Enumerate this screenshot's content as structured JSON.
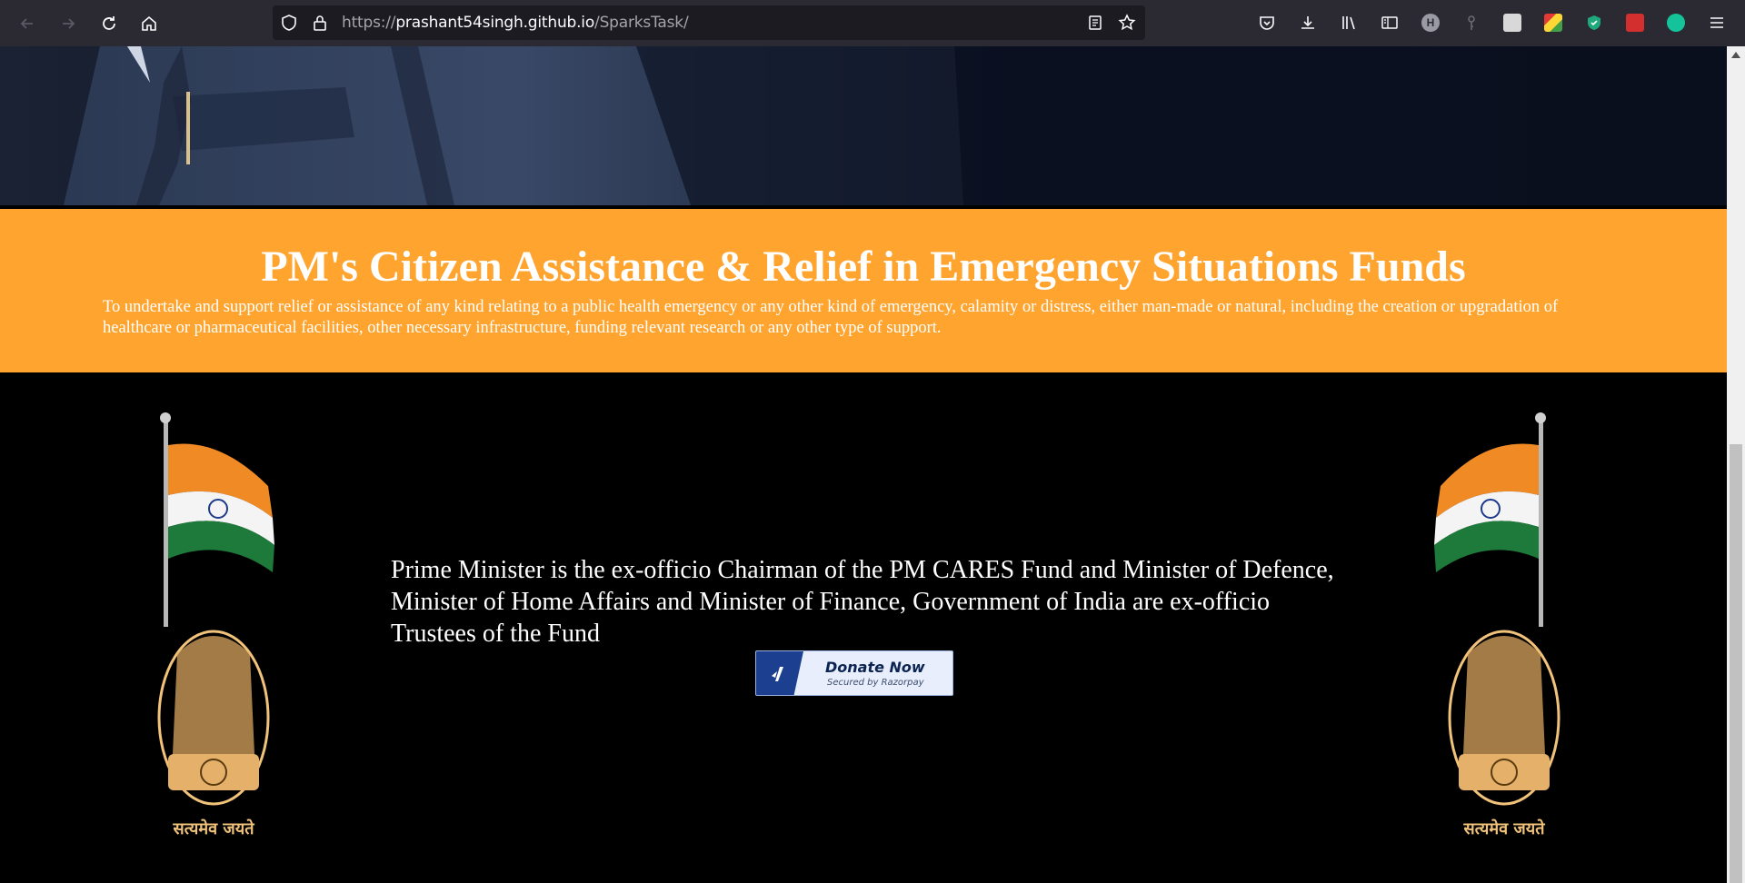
{
  "browser": {
    "url_scheme": "https://",
    "url_host": "prashant54singh.github.io",
    "url_path": "/SparksTask/",
    "ext_h_label": "H"
  },
  "page": {
    "banner_title": "PM's Citizen Assistance & Relief in Emergency Situations Funds",
    "banner_description": "To undertake and support relief or assistance of any kind relating to a public health emergency or any other kind of emergency, calamity or distress, either man-made or natural, including the creation or upgradation of healthcare or pharmaceutical facilities, other necessary infrastructure, funding relevant research or any other type of support.",
    "main_text": "Prime Minister is the ex-officio Chairman of the PM CARES Fund and Minister of Defence, Minister of Home Affairs and Minister of Finance, Government of India are ex-officio Trustees of the Fund",
    "motto_left": "सत्यमेव जयते",
    "motto_right": "सत्यमेव जयते",
    "donate": {
      "label": "Donate Now",
      "sublabel": "Secured by Razorpay"
    }
  },
  "colors": {
    "banner": "#ffa42f",
    "toolbar": "#2b2a33",
    "urlbar": "#1c1b22"
  }
}
